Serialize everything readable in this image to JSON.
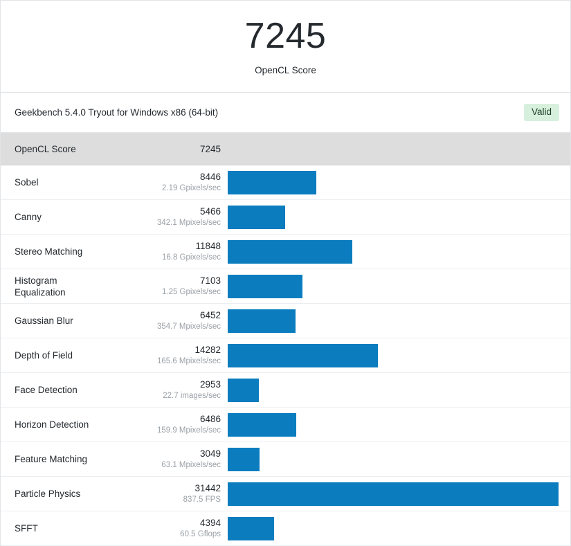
{
  "hero": {
    "score": "7245",
    "label": "OpenCL Score"
  },
  "meta": {
    "version_text": "Geekbench 5.4.0 Tryout for Windows x86 (64-bit)",
    "validity_badge": "Valid"
  },
  "section": {
    "name": "OpenCL Score",
    "score": "7245"
  },
  "colors": {
    "bar": "#0b7dbf",
    "section_bg": "#dddddd",
    "badge_bg": "#d7f0dd",
    "border": "#e1e4e8"
  },
  "chart_data": {
    "type": "bar",
    "title": "OpenCL Score",
    "xlabel": "",
    "ylabel": "",
    "orientation": "horizontal",
    "grid": false,
    "legend": "none",
    "xlim": [
      0,
      31442
    ],
    "categories": [
      "Sobel",
      "Canny",
      "Stereo Matching",
      "Histogram Equalization",
      "Gaussian Blur",
      "Depth of Field",
      "Face Detection",
      "Horizon Detection",
      "Feature Matching",
      "Particle Physics",
      "SFFT"
    ],
    "values": [
      8446,
      5466,
      11848,
      7103,
      6452,
      14282,
      2953,
      6486,
      3049,
      31442,
      4394
    ],
    "value_labels": [
      "8446",
      "5466",
      "11848",
      "7103",
      "6452",
      "14282",
      "2953",
      "6486",
      "3049",
      "31442",
      "4394"
    ],
    "annotations": [
      "2.19 Gpixels/sec",
      "342.1 Mpixels/sec",
      "16.8 Gpixels/sec",
      "1.25 Gpixels/sec",
      "354.7 Mpixels/sec",
      "165.6 Mpixels/sec",
      "22.7 images/sec",
      "159.9 Mpixels/sec",
      "63.1 Mpixels/sec",
      "837.5 FPS",
      "60.5 Gflops"
    ]
  },
  "rows": [
    {
      "name_line1": "Sobel",
      "name_line2": "",
      "score": "8446",
      "unit": "2.19 Gpixels/sec",
      "value": 8446
    },
    {
      "name_line1": "Canny",
      "name_line2": "",
      "score": "5466",
      "unit": "342.1 Mpixels/sec",
      "value": 5466
    },
    {
      "name_line1": "Stereo Matching",
      "name_line2": "",
      "score": "11848",
      "unit": "16.8 Gpixels/sec",
      "value": 11848
    },
    {
      "name_line1": "Histogram",
      "name_line2": "Equalization",
      "score": "7103",
      "unit": "1.25 Gpixels/sec",
      "value": 7103
    },
    {
      "name_line1": "Gaussian Blur",
      "name_line2": "",
      "score": "6452",
      "unit": "354.7 Mpixels/sec",
      "value": 6452
    },
    {
      "name_line1": "Depth of Field",
      "name_line2": "",
      "score": "14282",
      "unit": "165.6 Mpixels/sec",
      "value": 14282
    },
    {
      "name_line1": "Face Detection",
      "name_line2": "",
      "score": "2953",
      "unit": "22.7 images/sec",
      "value": 2953
    },
    {
      "name_line1": "Horizon Detection",
      "name_line2": "",
      "score": "6486",
      "unit": "159.9 Mpixels/sec",
      "value": 6486
    },
    {
      "name_line1": "Feature Matching",
      "name_line2": "",
      "score": "3049",
      "unit": "63.1 Mpixels/sec",
      "value": 3049
    },
    {
      "name_line1": "Particle Physics",
      "name_line2": "",
      "score": "31442",
      "unit": "837.5 FPS",
      "value": 31442
    },
    {
      "name_line1": "SFFT",
      "name_line2": "",
      "score": "4394",
      "unit": "60.5 Gflops",
      "value": 4394
    }
  ]
}
